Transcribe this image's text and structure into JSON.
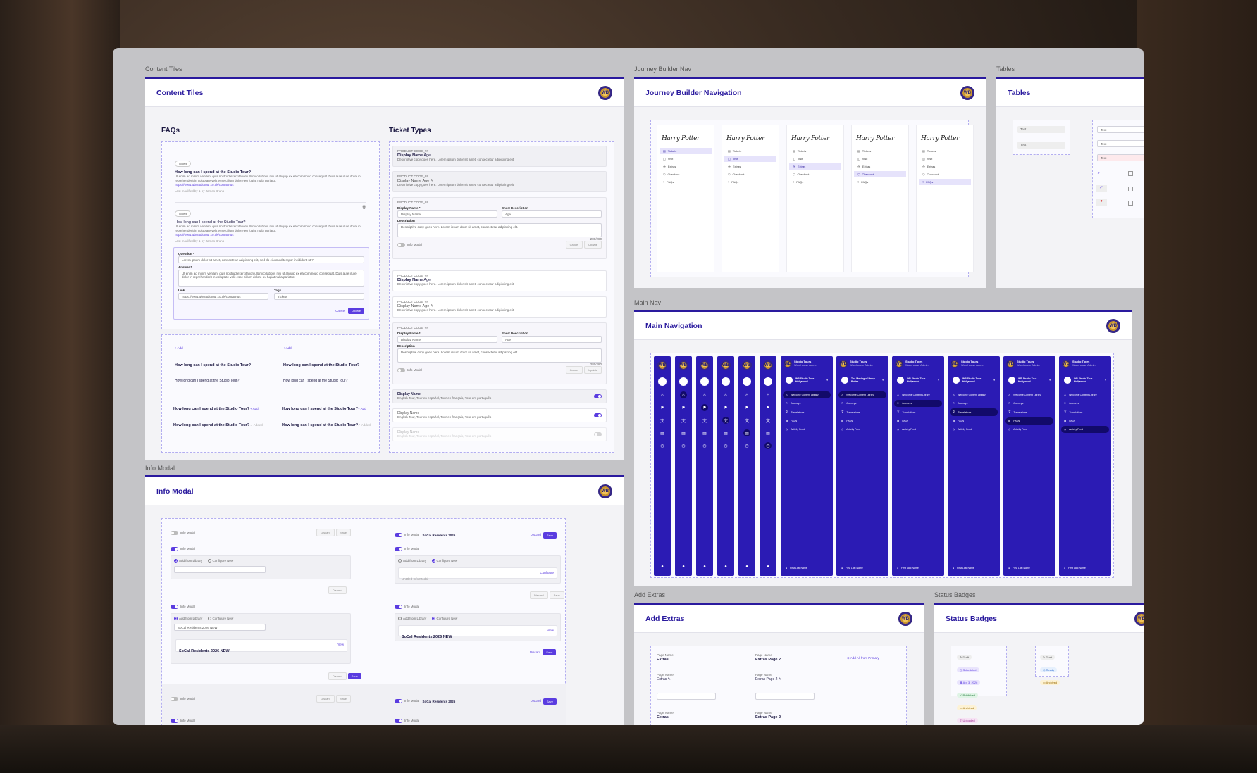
{
  "frames": {
    "content_tiles": {
      "label": "Content Tiles",
      "title": "Content Tiles"
    },
    "journey_nav": {
      "label": "Journey Builder Nav",
      "title": "Journey Builder Navigation"
    },
    "tables": {
      "label": "Tables",
      "title": "Tables"
    },
    "main_nav": {
      "label": "Main Nav",
      "title": "Main Navigation"
    },
    "info_modal": {
      "label": "Info Modal",
      "title": "Info Modal"
    },
    "add_extras": {
      "label": "Add Extras",
      "title": "Add Extras"
    },
    "status_badges": {
      "label": "Status Badges",
      "title": "Status Badges"
    }
  },
  "faqs": {
    "heading": "FAQs",
    "tag": "Tickets",
    "question": "How long can I spend at the Studio Tour?",
    "answer": "Ut enim ad minim veniam, quis nostrud exercitation ullamco laboris nisi ut aliquip ex ea commodo consequat. Duis aute irure dolor in reprehenderit in voluptate velit esse cillum dolore eu fugiat nulla pariatur.",
    "link": "https://www.wbstudiotour.co.uk/contact-us",
    "modified": "Last modified by 1 by James Bruno",
    "form": {
      "question_label": "Question *",
      "question_value": "Lorem ipsum dolor sit amet, consectetur adipiscing elit, sed do eiusmod tempor incididunt ut ?",
      "answer_label": "Answer *",
      "answer_value": "Ut enim ad minim veniam, quis nostrud exercitation ullamco laboris nisi ut aliquip ex ea commodo consequat. Duis aute irure dolor in reprehenderit in voluptate velit esse cillum dolore eu fugiat nulla pariatur.",
      "link_label": "Link",
      "link_value": "https://www.wbstudiotour.co.uk/contact-us",
      "tags_label": "Tags",
      "tags_value": "Tickets",
      "cancel": "Cancel",
      "update": "Update"
    },
    "add": "+ Add",
    "add_short": "+ Add",
    "added": "✓ Added"
  },
  "tickets": {
    "heading": "Ticket Types",
    "code": "PRODUCT CODE_##",
    "display_name": "Display Name",
    "age": "Age",
    "desc": "Descriptive copy goes here. Lorem ipsum dolor sit amet, consectetur adipiscing elit.",
    "dn_label": "Display Name *",
    "dn_placeholder": "Display Name",
    "sd_label": "Short Description",
    "sd_value": "Age",
    "desc_label": "Description",
    "counter": "280/280",
    "info_modal": "Info Modal",
    "cancel": "Cancel",
    "update": "Update",
    "lang": "English Tour, Tour en español, Tour en français, Tour em português"
  },
  "journey": {
    "brand": "Harry Potter",
    "items": [
      "Tickets",
      "Visit",
      "Extras",
      "Checkout",
      "FAQs"
    ]
  },
  "tables": {
    "cell": "Text"
  },
  "mainnav": {
    "brand": "Studio Tours",
    "sub": "Warehouse Admin",
    "site1": "WB Studio Tour Hollywood",
    "site2": "The Making of Harry Potter",
    "items": [
      "Welcome Content Library",
      "Journeys",
      "Translations",
      "FAQs",
      "Activity Feed"
    ],
    "user": "First Last Name"
  },
  "infomodal": {
    "label": "Info Modal",
    "named": "SoCal Residents 2026",
    "named_new": "SoCal Residents 2026 NEW",
    "discard": "Discard",
    "save": "Save",
    "add_lib": "Add from Library",
    "configure": "Configure New",
    "untitled": "Untitled Info Modal",
    "configure_link": "Configure",
    "view": "View"
  },
  "extras": {
    "page_name": "Page Name",
    "extras": "Extras",
    "extras_page2": "Extras Page 2",
    "add_all": "Add All from Primary"
  },
  "badges": {
    "draft": "Draft",
    "scheduled": "Scheduled",
    "date": "Apr 3, 2026",
    "published": "Published",
    "archived": "Archived",
    "uploaded": "Uploaded",
    "ready": "Ready"
  },
  "colors": {
    "accent": "#2a1a9e",
    "primary": "#5a3ce0",
    "nav": "#2b1bb4"
  }
}
